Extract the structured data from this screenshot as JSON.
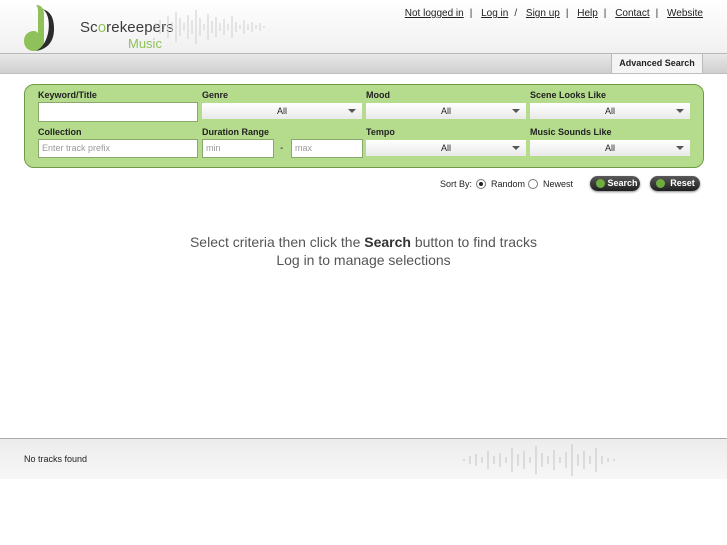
{
  "brand": {
    "name_pre": "Sc",
    "name_o": "o",
    "name_post": "rekeepers",
    "sub": "Music"
  },
  "toplinks": {
    "status": "Not logged in",
    "login": "Log in",
    "signup": "Sign up",
    "help": "Help",
    "contact": "Contact",
    "website": "Website"
  },
  "tab": {
    "advanced": "Advanced Search"
  },
  "filters": {
    "keyword": {
      "label": "Keyword/Title",
      "value": ""
    },
    "genre": {
      "label": "Genre",
      "value": "All"
    },
    "mood": {
      "label": "Mood",
      "value": "All"
    },
    "scene": {
      "label": "Scene Looks Like",
      "value": "All"
    },
    "collection": {
      "label": "Collection",
      "placeholder": "Enter track prefix"
    },
    "duration": {
      "label": "Duration Range",
      "min_placeholder": "min",
      "sep": "-",
      "max_placeholder": "max"
    },
    "tempo": {
      "label": "Tempo",
      "value": "All"
    },
    "sounds": {
      "label": "Music Sounds Like",
      "value": "All"
    }
  },
  "sort": {
    "label": "Sort By:",
    "options": [
      "Random",
      "Newest"
    ],
    "selected": "Random"
  },
  "buttons": {
    "search": "Search",
    "reset": "Reset"
  },
  "messages": {
    "line1_pre": "Select criteria then click the ",
    "line1_bold": "Search",
    "line1_post": " button to find tracks",
    "line2": "Log in to manage selections"
  },
  "footer": {
    "status": "No tracks found"
  },
  "colors": {
    "panel": "#b5dc8d",
    "accent": "#8fc15a"
  }
}
